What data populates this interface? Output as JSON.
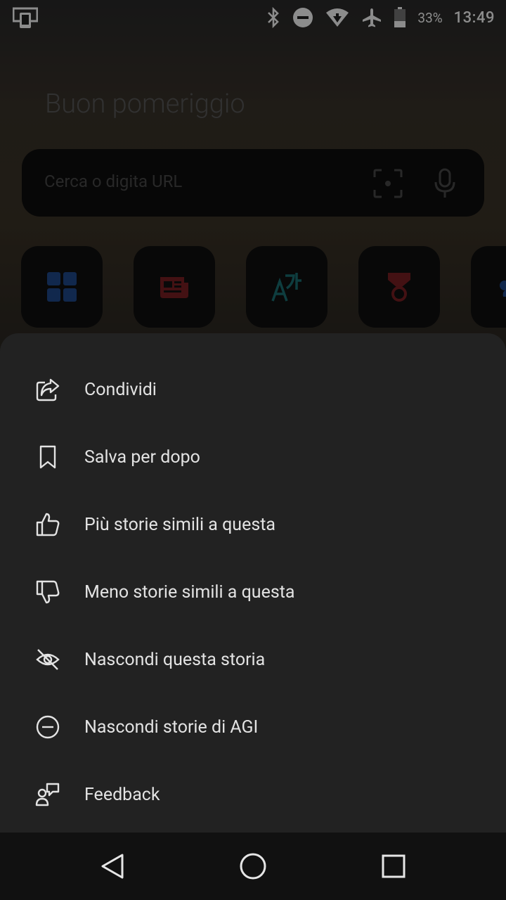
{
  "status_bar": {
    "battery_percent": "33%",
    "time": "13:49",
    "icons": [
      "screen-mirror-icon",
      "bluetooth-icon",
      "do-not-disturb-icon",
      "wifi-icon",
      "airplane-icon",
      "battery-icon"
    ]
  },
  "home": {
    "greeting": "Buon pomeriggio",
    "search_placeholder": "Cerca o digita URL",
    "tiles": [
      "apps-grid-icon",
      "news-icon",
      "translate-icon",
      "rewards-icon",
      "weather-icon"
    ]
  },
  "menu": {
    "items": [
      {
        "label": "Condividi",
        "icon": "share-icon"
      },
      {
        "label": "Salva per dopo",
        "icon": "bookmark-icon"
      },
      {
        "label": "Più storie simili a questa",
        "icon": "thumbs-up-icon"
      },
      {
        "label": "Meno storie simili a questa",
        "icon": "thumbs-down-icon"
      },
      {
        "label": "Nascondi questa storia",
        "icon": "eye-off-icon"
      },
      {
        "label": "Nascondi storie di AGI",
        "icon": "block-icon"
      },
      {
        "label": "Feedback",
        "icon": "feedback-icon"
      }
    ]
  },
  "colors": {
    "sheet_bg": "#222222",
    "tile_blue": "#1f4a8c",
    "tile_red": "#7a1f24",
    "tile_teal": "#1b6f73"
  }
}
